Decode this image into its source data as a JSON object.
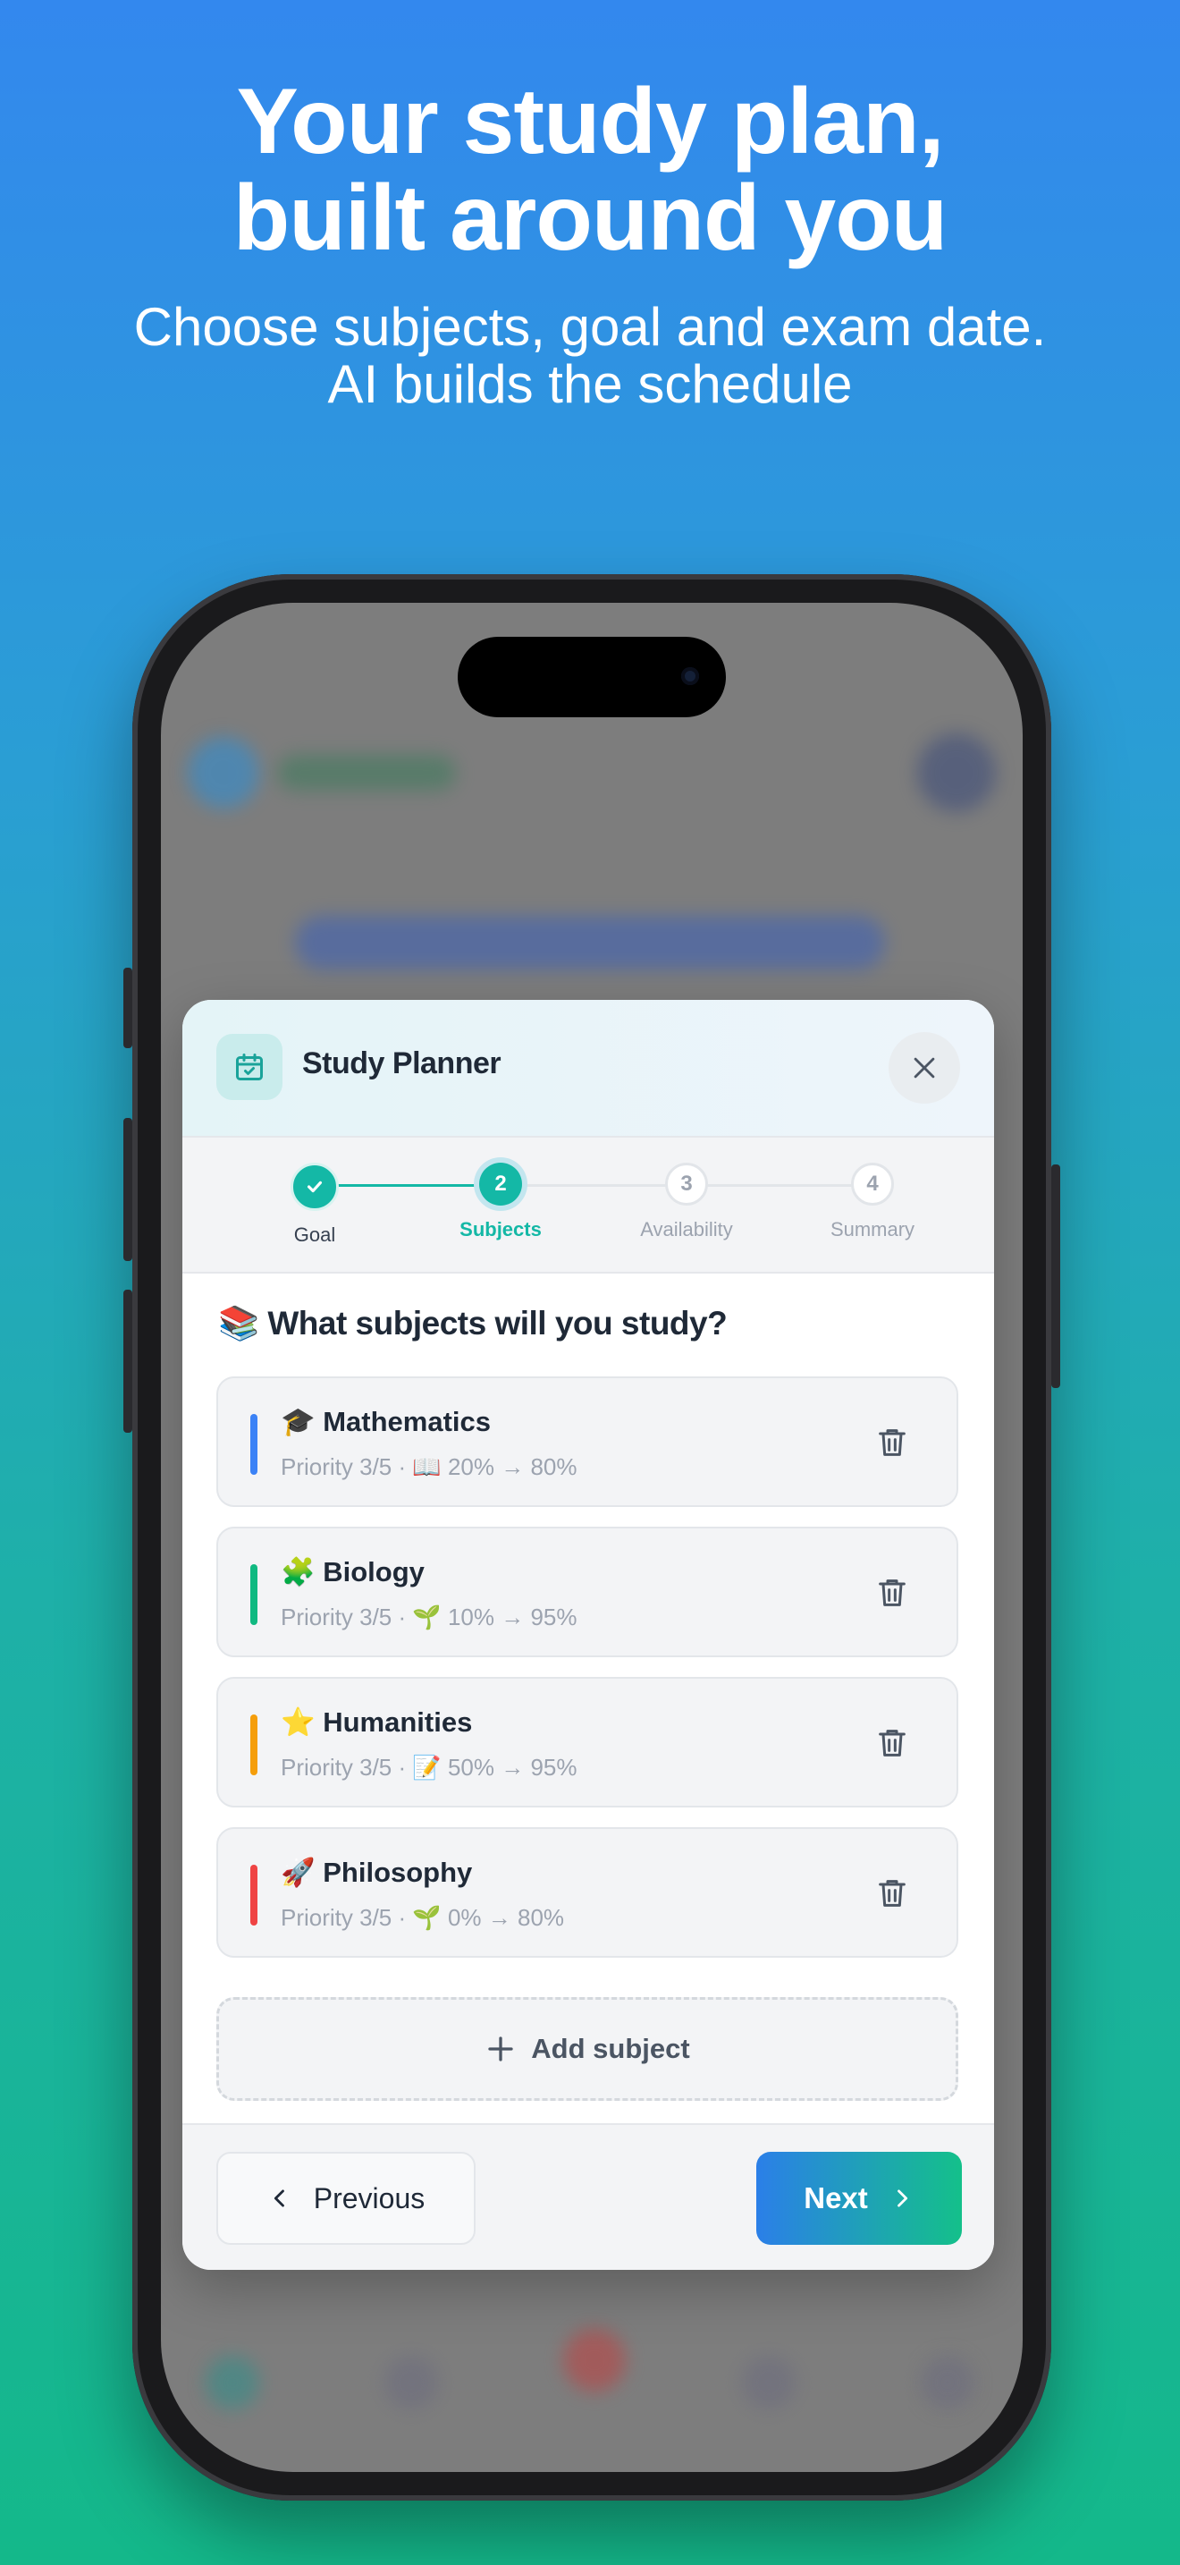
{
  "hero": {
    "title_line1": "Your study plan,",
    "title_line2": "built around you",
    "subtitle_line1": "Choose subjects, goal and exam date.",
    "subtitle_line2": "AI builds the schedule"
  },
  "modal": {
    "title": "Study Planner",
    "steps": [
      {
        "number": "1",
        "label": "Goal",
        "state": "done"
      },
      {
        "number": "2",
        "label": "Subjects",
        "state": "active"
      },
      {
        "number": "3",
        "label": "Availability",
        "state": "pending"
      },
      {
        "number": "4",
        "label": "Summary",
        "state": "pending"
      }
    ],
    "question": "What subjects will you study?",
    "question_icon": "📚",
    "subjects": [
      {
        "emoji": "🎓",
        "name": "Mathematics",
        "meta": "Priority 3/5 · 📖 20% → 80%",
        "color": "#3b82f6"
      },
      {
        "emoji": "🧩",
        "name": "Biology",
        "meta": "Priority 3/5 · 🌱 10% → 95%",
        "color": "#10b981"
      },
      {
        "emoji": "⭐",
        "name": "Humanities",
        "meta": "Priority 3/5 · 📝 50% → 95%",
        "color": "#f59e0b"
      },
      {
        "emoji": "🚀",
        "name": "Philosophy",
        "meta": "Priority 3/5 · 🌱 0% → 80%",
        "color": "#ef4444"
      }
    ],
    "add_label": "Add subject",
    "prev_label": "Previous",
    "next_label": "Next"
  },
  "colors": {
    "accent": "#14b8a6",
    "next_gradient_start": "#2b7fe8",
    "next_gradient_end": "#14c08a"
  }
}
